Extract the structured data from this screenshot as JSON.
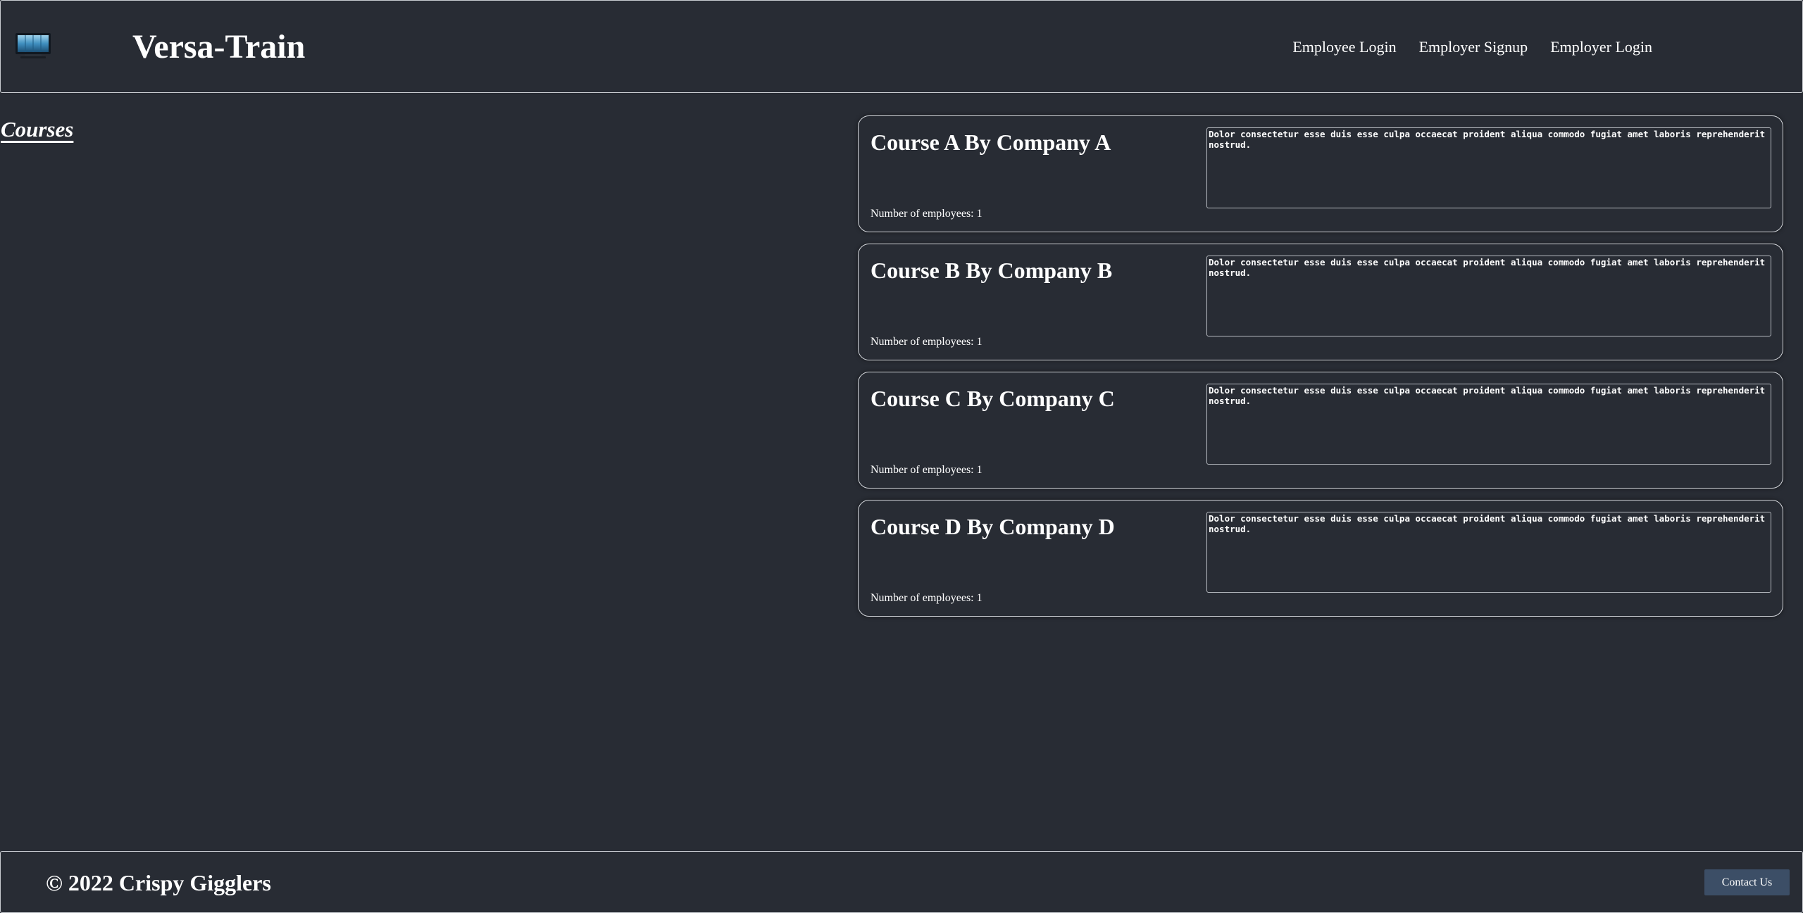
{
  "header": {
    "logo_icon": "computer-monitor-icon",
    "title": "Versa-Train",
    "nav": [
      {
        "label": "Employee Login"
      },
      {
        "label": "Employer Signup"
      },
      {
        "label": "Employer Login"
      }
    ]
  },
  "main": {
    "heading": "Courses",
    "courses": [
      {
        "title": "Course A By Company A",
        "description": "Dolor consectetur esse duis esse culpa occaecat proident aliqua commodo fugiat amet laboris reprehenderit nostrud.",
        "employees": "Number of employees: 1"
      },
      {
        "title": "Course B By Company B",
        "description": "Dolor consectetur esse duis esse culpa occaecat proident aliqua commodo fugiat amet laboris reprehenderit nostrud.",
        "employees": "Number of employees: 1"
      },
      {
        "title": "Course C By Company C",
        "description": "Dolor consectetur esse duis esse culpa occaecat proident aliqua commodo fugiat amet laboris reprehenderit nostrud.",
        "employees": "Number of employees: 1"
      },
      {
        "title": "Course D By Company D",
        "description": "Dolor consectetur esse duis esse culpa occaecat proident aliqua commodo fugiat amet laboris reprehenderit nostrud.",
        "employees": "Number of employees: 1"
      }
    ]
  },
  "footer": {
    "copyright": "© 2022 Crispy Gigglers",
    "contact_label": "Contact Us"
  },
  "colors": {
    "background": "#282c34",
    "border": "#c9ccd1",
    "button": "#3c4e66",
    "text": "#ffffff"
  }
}
